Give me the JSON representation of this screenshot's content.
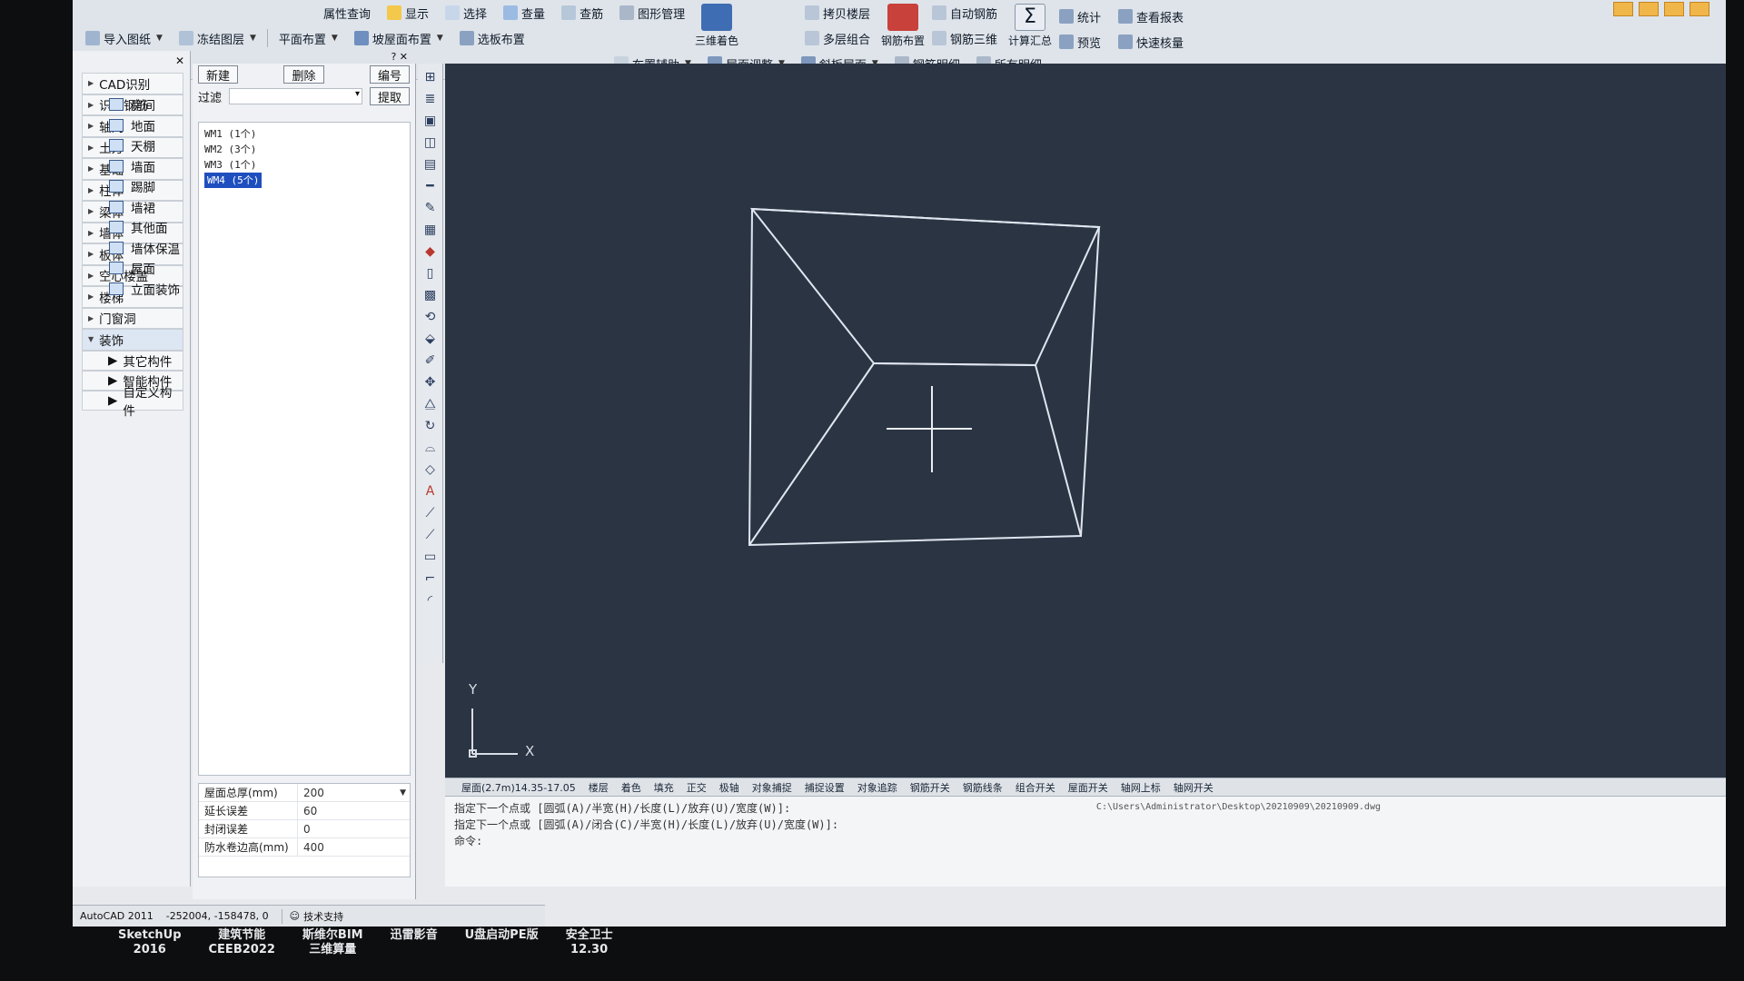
{
  "ribbon": {
    "row1": [
      "属性查询",
      "显示",
      "选择",
      "查量",
      "查筋",
      "图形管理"
    ],
    "row2": [
      "导入图纸",
      "冻结图层",
      "平面布置",
      "坡屋面布置",
      "选板布置"
    ],
    "row3": [
      "布置辅助",
      "屋面调整",
      "斜板屋面",
      "钢筋明细",
      "所有明细"
    ],
    "big": [
      "三维着色",
      "钢筋布置",
      "计算汇总"
    ],
    "right_small": [
      "拷贝楼层",
      "多层组合",
      "自动钢筋",
      "钢筋三维",
      "统计",
      "预览",
      "查看报表",
      "快速核量"
    ]
  },
  "tree": {
    "items": [
      "CAD识别",
      "识别钢筋",
      "轴网",
      "土方",
      "基础",
      "柱体",
      "梁体",
      "墙体",
      "板体",
      "空心楼盖",
      "楼梯",
      "门窗洞",
      "装饰"
    ],
    "sub_items": [
      "房间",
      "地面",
      "天棚",
      "墙面",
      "踢脚",
      "墙裙",
      "其他面",
      "墙体保温",
      "屋面",
      "立面装饰"
    ],
    "groups": [
      "其它构件",
      "智能构件",
      "自定义构件"
    ]
  },
  "panel": {
    "new_label": "新建",
    "delete_label": "删除",
    "code_label": "编号",
    "filter_label": "过滤",
    "extract_label": "提取",
    "list": [
      "WM1 (1个)",
      "WM2 (3个)",
      "WM3 (1个)",
      "WM4 (5个)"
    ],
    "selected_index": 3,
    "props": [
      {
        "k": "屋面总厚(mm)",
        "v": "200"
      },
      {
        "k": "延长误差",
        "v": "60"
      },
      {
        "k": "封闭误差",
        "v": "0"
      },
      {
        "k": "防水卷边高(mm)",
        "v": "400"
      }
    ]
  },
  "canvas": {
    "axis_y": "Y",
    "axis_x": "X"
  },
  "statusbar": [
    "屋面(2.7m)14.35-17.05",
    "楼层",
    "着色",
    "填充",
    "正交",
    "极轴",
    "对象捕捉",
    "捕捉设置",
    "对象追踪",
    "钢筋开关",
    "钢筋线条",
    "组合开关",
    "屋面开关",
    "轴网上标",
    "轴网开关"
  ],
  "command": {
    "line1": "指定下一个点或 [圆弧(A)/半宽(H)/长度(L)/放弃(U)/宽度(W)]:",
    "line2": "指定下一个点或 [圆弧(A)/闭合(C)/半宽(H)/长度(L)/放弃(U)/宽度(W)]:",
    "prompt": "命令:",
    "path": "C:\\Users\\Administrator\\Desktop\\20210909\\20210909.dwg"
  },
  "bottombar": {
    "app": "AutoCAD 2011",
    "coords": "-252004, -158478, 0",
    "support": "技术支持"
  },
  "taskbar": [
    {
      "l1": "SketchUp",
      "l2": "2016"
    },
    {
      "l1": "建筑节能",
      "l2": "CEEB2022"
    },
    {
      "l1": "斯维尔BIM",
      "l2": "三维算量"
    },
    {
      "l1": "迅雷影音",
      "l2": ""
    },
    {
      "l1": "U盘启动PE版",
      "l2": ""
    },
    {
      "l1": "安全卫士",
      "l2": "12.30"
    }
  ],
  "colors": {
    "canvas_bg": "#2b3443",
    "line": "#dfe6f0",
    "accent": "#1f4fbf"
  }
}
